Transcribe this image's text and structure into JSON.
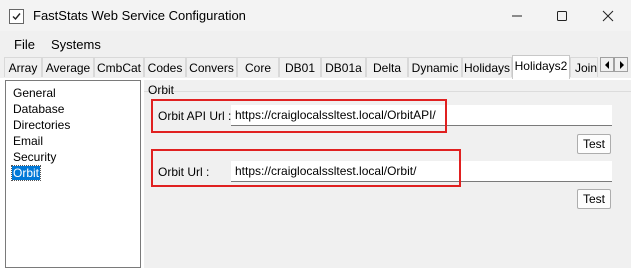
{
  "window": {
    "title": "FastStats Web Service Configuration"
  },
  "menu": [
    {
      "label": "File"
    },
    {
      "label": "Systems"
    }
  ],
  "tabs": [
    {
      "label": "Array"
    },
    {
      "label": "Average"
    },
    {
      "label": "CmbCat"
    },
    {
      "label": "Codes"
    },
    {
      "label": "Convers"
    },
    {
      "label": "Core"
    },
    {
      "label": "DB01"
    },
    {
      "label": "DB01a"
    },
    {
      "label": "Delta"
    },
    {
      "label": "Dynamic"
    },
    {
      "label": "Holidays"
    },
    {
      "label": "Holidays2"
    },
    {
      "label": "Joins"
    }
  ],
  "active_tab": "Holidays2",
  "tree": [
    {
      "label": "General"
    },
    {
      "label": "Database"
    },
    {
      "label": "Directories"
    },
    {
      "label": "Email"
    },
    {
      "label": "Security"
    },
    {
      "label": "Orbit"
    }
  ],
  "selected_tree_item": "Orbit",
  "orbit_group": {
    "title": "Orbit",
    "api_url": {
      "label": "Orbit API Url :",
      "value": "https://craiglocalssltest.local/OrbitAPI/",
      "test_label": "Test"
    },
    "url": {
      "label": "Orbit Url :",
      "value": "https://craiglocalssltest.local/Orbit/",
      "test_label": "Test"
    }
  },
  "colors": {
    "highlight": "#e02020",
    "selection": "#0078d7"
  }
}
